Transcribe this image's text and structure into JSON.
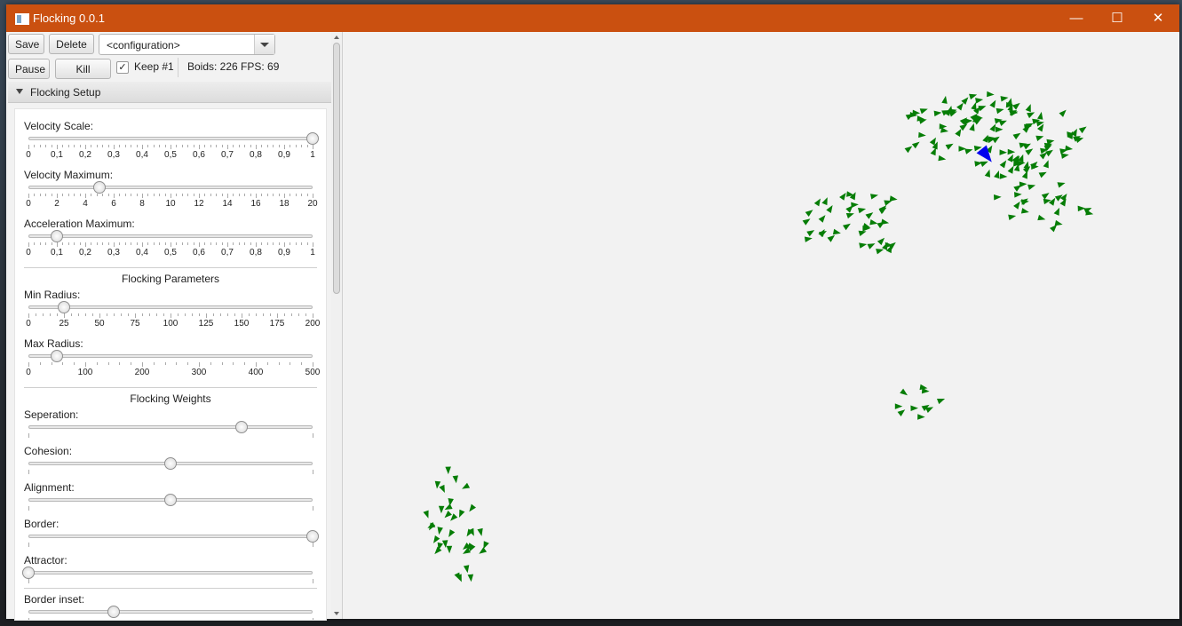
{
  "window": {
    "title": "Flocking 0.0.1"
  },
  "toolbar": {
    "save_label": "Save",
    "delete_label": "Delete",
    "config_value": "<configuration>",
    "pause_label": "Pause",
    "kill_label": "Kill Boids",
    "keep_label": "Keep #1",
    "keep_checked": true,
    "stats": "Boids: 226  FPS: 69"
  },
  "panel": {
    "title": "Flocking Setup",
    "sliders": [
      {
        "label": "Velocity Scale:",
        "value": 1.0,
        "min": 0,
        "max": 1,
        "ticks": [
          "0",
          "0,1",
          "0,2",
          "0,3",
          "0,4",
          "0,5",
          "0,6",
          "0,7",
          "0,8",
          "0,9",
          "1"
        ],
        "minor": 5
      },
      {
        "label": "Velocity Maximum:",
        "value": 5,
        "min": 0,
        "max": 20,
        "ticks": [
          "0",
          "2",
          "4",
          "6",
          "8",
          "10",
          "12",
          "14",
          "16",
          "18",
          "20"
        ],
        "minor": 5
      },
      {
        "label": "Acceleration Maximum:",
        "value": 0.1,
        "min": 0,
        "max": 1,
        "ticks": [
          "0",
          "0,1",
          "0,2",
          "0,3",
          "0,4",
          "0,5",
          "0,6",
          "0,7",
          "0,8",
          "0,9",
          "1"
        ],
        "minor": 5
      },
      {
        "label": "Min Radius:",
        "value": 25,
        "min": 0,
        "max": 200,
        "ticks": [
          "0",
          "25",
          "50",
          "75",
          "100",
          "125",
          "150",
          "175",
          "200"
        ],
        "minor": 5
      },
      {
        "label": "Max Radius:",
        "value": 50,
        "min": 0,
        "max": 500,
        "ticks": [
          "0",
          "100",
          "200",
          "300",
          "400",
          "500"
        ],
        "minor": 5
      },
      {
        "label": "Seperation:",
        "value": 0.75,
        "min": 0,
        "max": 1,
        "ticks": [],
        "minor": 0
      },
      {
        "label": "Cohesion:",
        "value": 0.5,
        "min": 0,
        "max": 1,
        "ticks": [],
        "minor": 0
      },
      {
        "label": "Alignment:",
        "value": 0.5,
        "min": 0,
        "max": 1,
        "ticks": [],
        "minor": 0
      },
      {
        "label": "Border:",
        "value": 1.0,
        "min": 0,
        "max": 1,
        "ticks": [],
        "minor": 0
      },
      {
        "label": "Attractor:",
        "value": 0.0,
        "min": 0,
        "max": 1,
        "ticks": [],
        "minor": 0
      },
      {
        "label": "Border inset:",
        "value": 0.3,
        "min": 0,
        "max": 1,
        "ticks": [],
        "minor": 0
      }
    ],
    "section_parameters": "Flocking Parameters",
    "section_weights": "Flocking Weights"
  },
  "colors": {
    "titlebar": "#ca5010",
    "boid": "#067d06",
    "highlighted_boid": "#0000ee"
  }
}
